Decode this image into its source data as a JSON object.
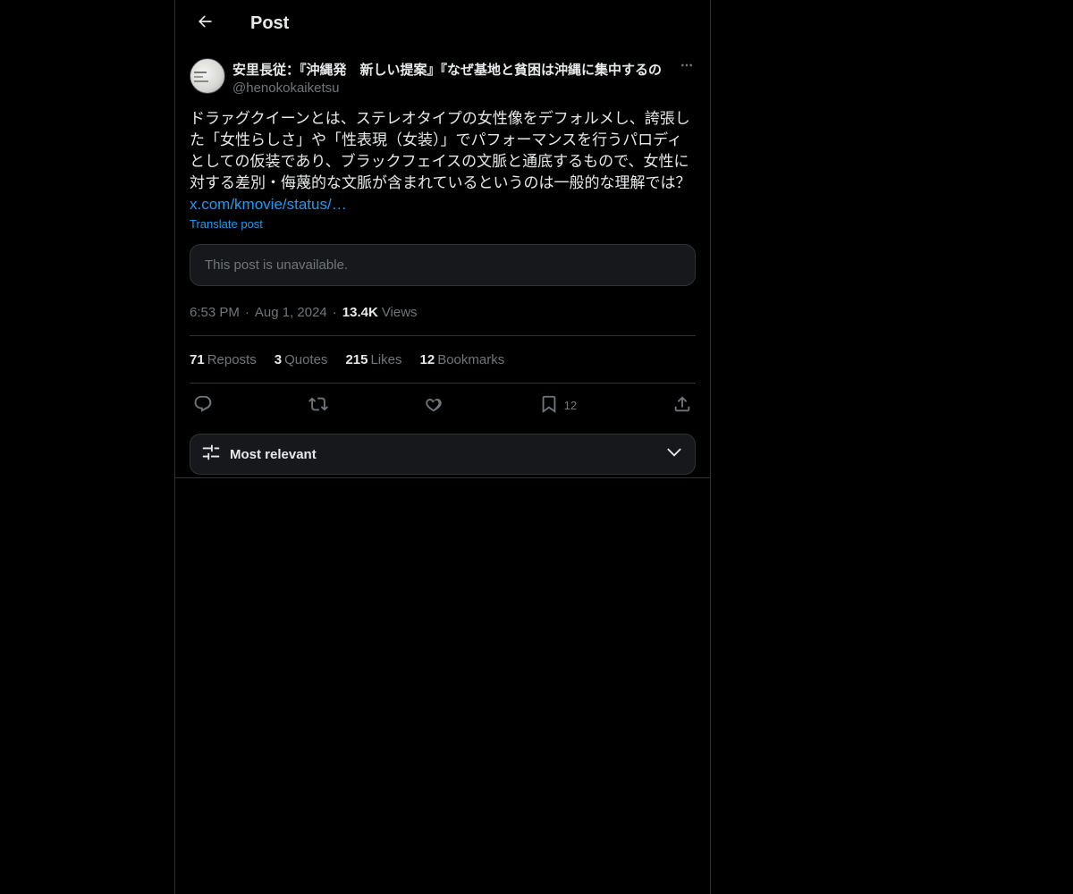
{
  "header": {
    "title": "Post",
    "back_icon": "arrow-left-icon"
  },
  "post": {
    "author_display_name": "安里長従：『沖縄発　新しい提案』『なぜ基地と貧困は沖縄に集中するの",
    "author_handle": "@henokokaiketsu",
    "text": "ドラァグクイーンとは、ステレオタイプの女性像をデフォルメし、誇張した「女性らしさ」や「性表現（女装）」でパフォーマンスを行うパロディとしての仮装であり、ブラックフェイスの文脈と通底するもので、女性に対する差別・侮蔑的な文脈が含まれているというのは一般的な理解では？",
    "link": "x.com/kmovie/status/…",
    "translate_label": "Translate post",
    "quoted_unavailable": "This post is unavailable.",
    "time": "6:53 PM",
    "date": "Aug 1, 2024",
    "views_count": "13.4K",
    "views_label": "Views",
    "separator": "·"
  },
  "stats": {
    "reposts": {
      "count": "71",
      "label": "Reposts"
    },
    "quotes": {
      "count": "3",
      "label": "Quotes"
    },
    "likes": {
      "count": "215",
      "label": "Likes"
    },
    "bookmarks": {
      "count": "12",
      "label": "Bookmarks"
    }
  },
  "actions": {
    "reply_icon": "reply-icon",
    "repost_icon": "repost-icon",
    "like_icon": "heart-icon",
    "bookmark_icon": "bookmark-icon",
    "bookmark_count": "12",
    "share_icon": "share-icon"
  },
  "sort": {
    "label": "Most relevant"
  },
  "colors": {
    "background": "#000000",
    "text": "#e7e9ea",
    "secondary": "#71767b",
    "accent": "#1d9bf0",
    "border": "#2f3336"
  }
}
